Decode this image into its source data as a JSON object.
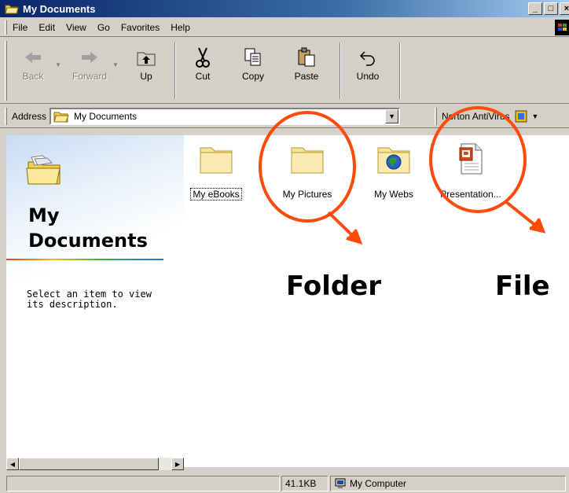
{
  "window": {
    "title": "My Documents",
    "icon": "folder-open-icon"
  },
  "menu": [
    "File",
    "Edit",
    "View",
    "Go",
    "Favorites",
    "Help"
  ],
  "toolbar": {
    "back": "Back",
    "forward": "Forward",
    "up": "Up",
    "cut": "Cut",
    "copy": "Copy",
    "paste": "Paste",
    "undo": "Undo"
  },
  "address": {
    "label": "Address",
    "value": "My Documents",
    "norton": "Norton AntiVirus"
  },
  "left_pane": {
    "heading_line1": "My",
    "heading_line2": "Documents",
    "description": "Select an item to view its description."
  },
  "items": [
    {
      "name": "My eBooks",
      "icon": "folder-icon",
      "selected": true
    },
    {
      "name": "My Pictures",
      "icon": "folder-icon",
      "selected": false
    },
    {
      "name": "My Webs",
      "icon": "web-folder-icon",
      "selected": false
    },
    {
      "name": "Presentation...",
      "icon": "powerpoint-file-icon",
      "selected": false
    }
  ],
  "annotations": {
    "folder_label": "Folder",
    "file_label": "File",
    "color": "#ff4a0a"
  },
  "status": {
    "size": "41.1KB",
    "location": "My Computer"
  }
}
